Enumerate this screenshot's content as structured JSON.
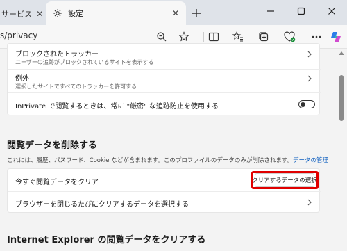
{
  "tabs": {
    "inactive_label": "サービス＆サ",
    "active_label": "設定"
  },
  "address_bar": {
    "url": "s/privacy"
  },
  "tracking_card": {
    "blocked_title": "ブロックされたトラッカー",
    "blocked_desc": "ユーザーの追跡がブロックされているサイトを表示する",
    "exceptions_title": "例外",
    "exceptions_desc": "選択したサイトですべてのトラッカーを許可する",
    "inprivate_label": "InPrivate で閲覧するときは、常に \"厳密\" な追跡防止を使用する",
    "inprivate_toggle": "off"
  },
  "clear_section": {
    "title": "閲覧データを削除する",
    "desc": "これには、履歴、パスワード、Cookie などが含まれます。このプロファイルのデータのみが削除されます。",
    "manage_link": "データの管理",
    "clear_now_label": "今すぐ閲覧データをクリア",
    "choose_button": "クリアするデータの選択",
    "on_close_label": "ブラウザーを閉じるたびにクリアするデータを選択する"
  },
  "ie_section": {
    "title": "Internet Explorer の閲覧データをクリアする"
  },
  "colors": {
    "highlight": "#e00000",
    "link": "#0f5fbf"
  }
}
